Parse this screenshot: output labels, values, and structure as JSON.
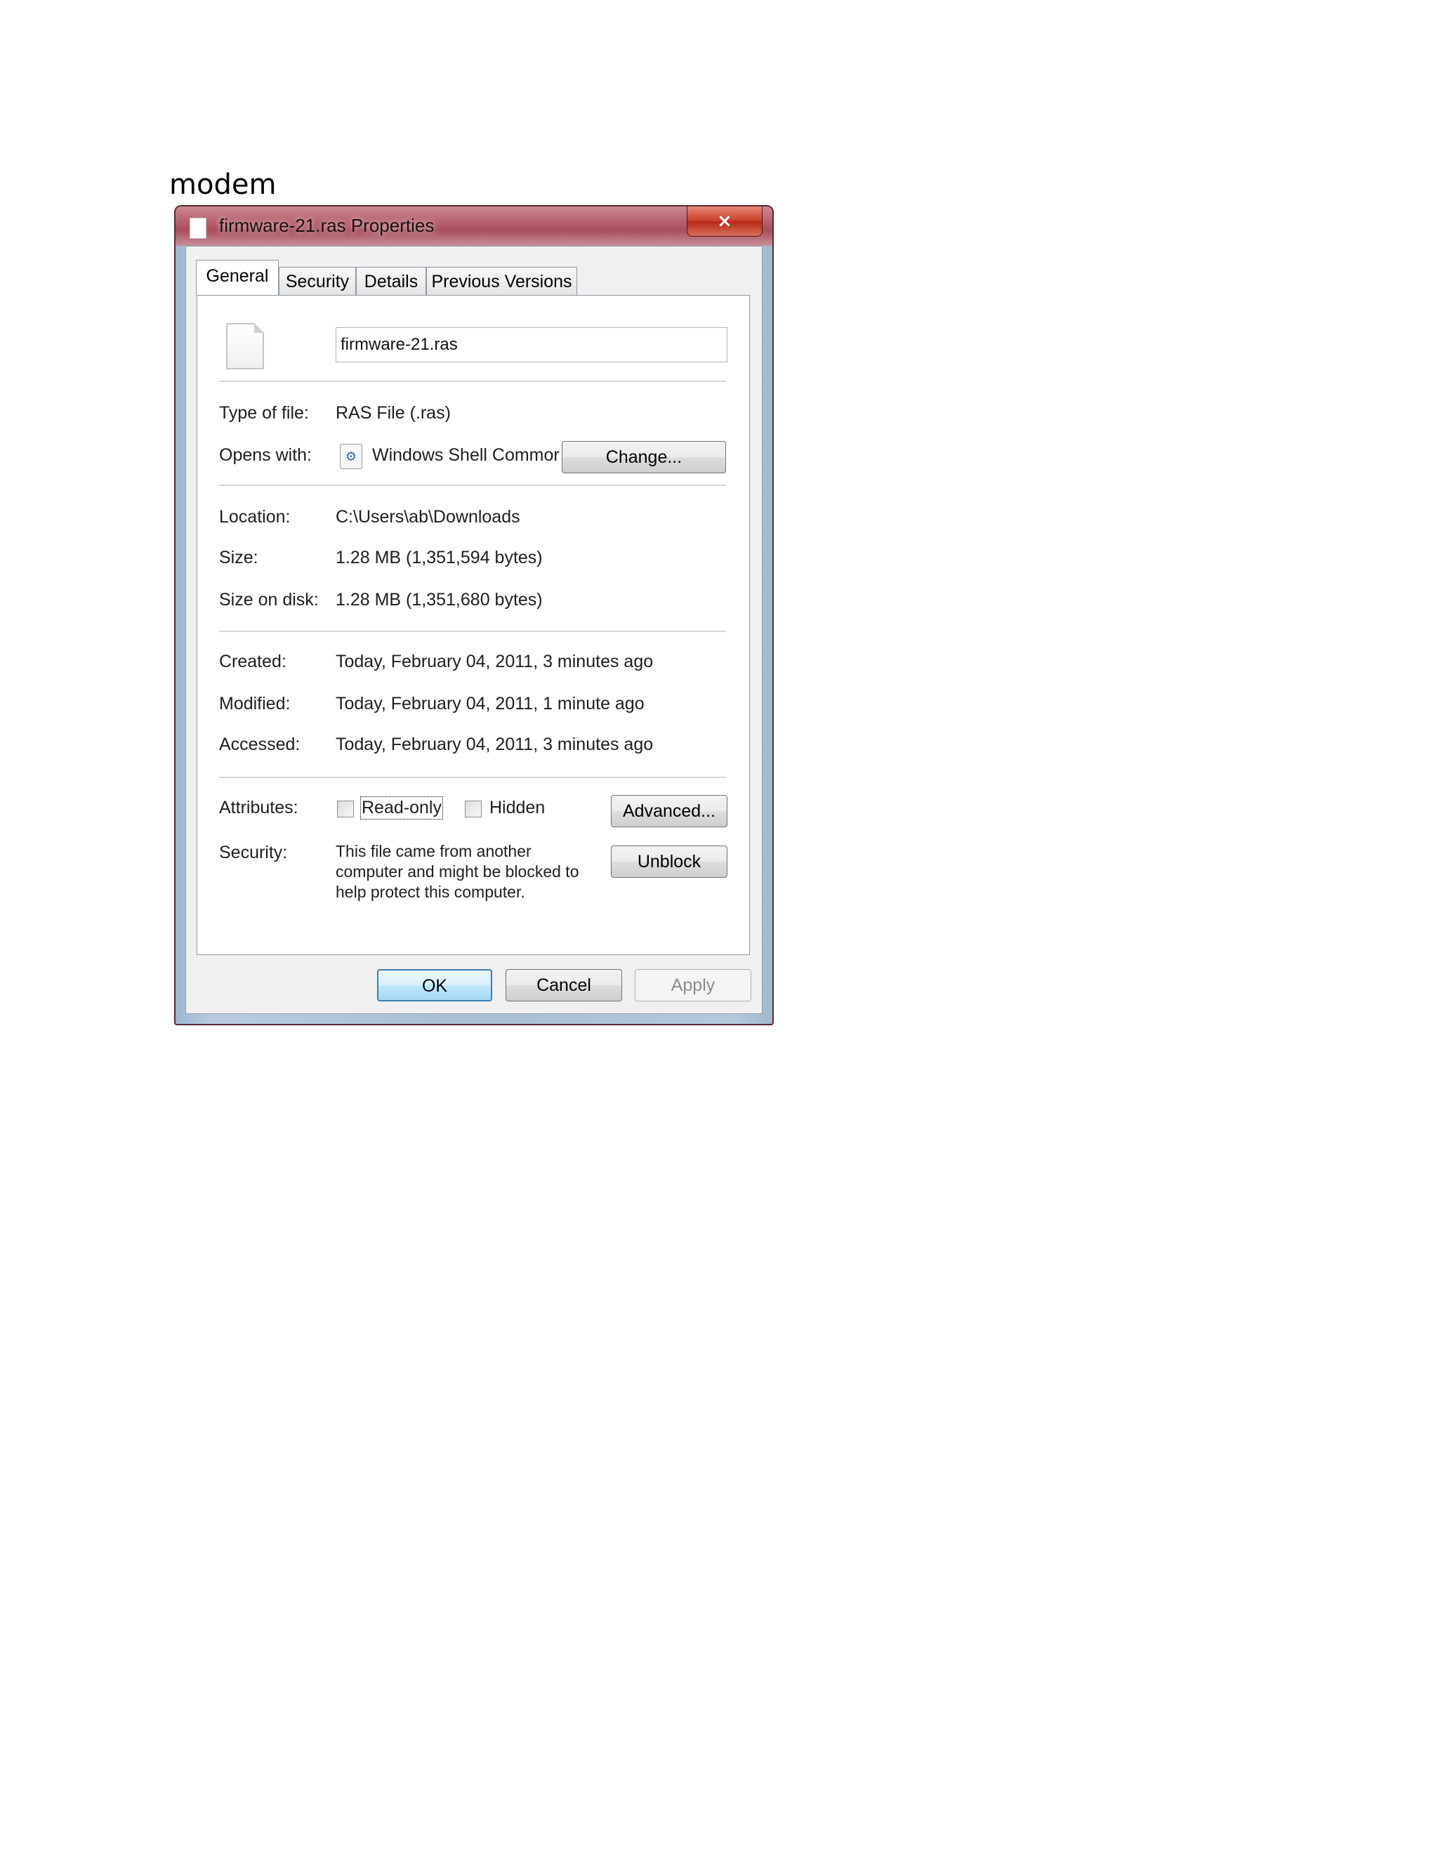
{
  "document": {
    "caption": "modem"
  },
  "window": {
    "title": "firmware-21.ras Properties",
    "close_glyph": "×",
    "icons": {
      "title": "document-icon",
      "file": "blank-file-icon",
      "app": "windows-shell-icon"
    }
  },
  "tabs": [
    {
      "label": "General",
      "active": true
    },
    {
      "label": "Security",
      "active": false
    },
    {
      "label": "Details",
      "active": false
    },
    {
      "label": "Previous Versions",
      "active": false
    }
  ],
  "general": {
    "file_name": "firmware-21.ras",
    "type_label": "Type of file:",
    "type_value": "RAS File (.ras)",
    "opens_label": "Opens with:",
    "opens_value": "Windows Shell Commor",
    "change_button": "Change...",
    "location_label": "Location:",
    "location_value": "C:\\Users\\ab\\Downloads",
    "size_label": "Size:",
    "size_value": "1.28 MB (1,351,594 bytes)",
    "size_disk_label": "Size on disk:",
    "size_disk_value": "1.28 MB (1,351,680 bytes)",
    "created_label": "Created:",
    "created_value": "Today, February 04, 2011, 3 minutes ago",
    "modified_label": "Modified:",
    "modified_value": "Today, February 04, 2011, 1 minute ago",
    "accessed_label": "Accessed:",
    "accessed_value": "Today, February 04, 2011, 3 minutes ago",
    "attributes_label": "Attributes:",
    "readonly_label": "Read-only",
    "readonly_checked": false,
    "hidden_label": "Hidden",
    "hidden_checked": false,
    "advanced_button": "Advanced...",
    "security_label": "Security:",
    "security_text": "This file came from another computer and might be blocked to help protect this computer.",
    "unblock_button": "Unblock"
  },
  "footer": {
    "ok": "OK",
    "cancel": "Cancel",
    "apply": "Apply",
    "apply_enabled": false
  }
}
